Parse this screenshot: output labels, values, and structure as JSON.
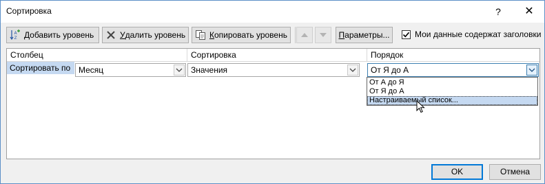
{
  "window": {
    "title": "Сортировка",
    "help_glyph": "?",
    "close_glyph": "✕"
  },
  "toolbar": {
    "add_level": {
      "accel": "Д",
      "rest": "обавить уровень"
    },
    "delete_level": {
      "accel": "У",
      "rest": "далить уровень"
    },
    "copy_level": {
      "accel": "К",
      "rest": "опировать уровень"
    },
    "parameters": {
      "accel": "П",
      "rest": "араметры..."
    },
    "headers_checkbox": {
      "label": "Мои данные содержат заголовки",
      "checked": true
    }
  },
  "grid": {
    "headers": [
      "Столбец",
      "Сортировка",
      "Порядок"
    ],
    "row": {
      "label": "Сортировать по",
      "column_value": "Месяц",
      "sort_on_value": "Значения",
      "order_value": "От Я до А"
    }
  },
  "order_dropdown": {
    "options": [
      "От А до Я",
      "От Я до А",
      "Настраиваемый список..."
    ],
    "selected_index": 2
  },
  "footer": {
    "ok_label": "OK",
    "cancel_label": "Отмена"
  },
  "colors": {
    "dialog_border": "#5b8fc7",
    "selection": "#c5d9f1",
    "default_button_border": "#0078d7"
  }
}
